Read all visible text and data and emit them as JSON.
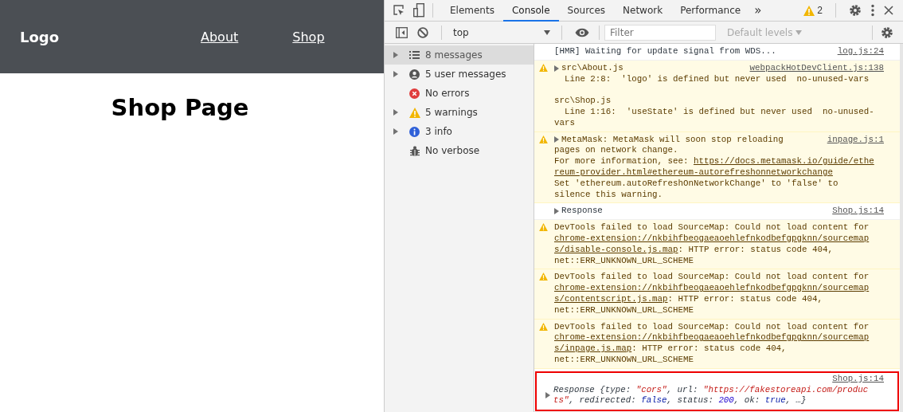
{
  "app": {
    "logo": "Logo",
    "nav_links": [
      {
        "label": "About"
      },
      {
        "label": "Shop"
      }
    ],
    "heading": "Shop Page"
  },
  "devtools": {
    "tabs": [
      {
        "label": "Elements",
        "selected": false
      },
      {
        "label": "Console",
        "selected": true
      },
      {
        "label": "Sources",
        "selected": false
      },
      {
        "label": "Network",
        "selected": false
      },
      {
        "label": "Performance",
        "selected": false
      }
    ],
    "more_tabs": "»",
    "warning_count": "2",
    "context": "top",
    "filter": {
      "placeholder": "Filter"
    },
    "levels": "Default levels",
    "sidebar": [
      {
        "label": "8 messages",
        "kind": "all",
        "expandable": true,
        "selected": true
      },
      {
        "label": "5 user messages",
        "kind": "user",
        "expandable": true,
        "selected": false
      },
      {
        "label": "No errors",
        "kind": "error",
        "expandable": false,
        "selected": false
      },
      {
        "label": "5 warnings",
        "kind": "warning",
        "expandable": true,
        "selected": false
      },
      {
        "label": "3 info",
        "kind": "info",
        "expandable": true,
        "selected": false
      },
      {
        "label": "No verbose",
        "kind": "verbose",
        "expandable": false,
        "selected": false
      }
    ],
    "messages": [
      {
        "kind": "log",
        "expandable": false,
        "highlighted": false,
        "source": "log.js:24",
        "lines": [
          {
            "gap_before": false,
            "parts": [
              {
                "kind": "text",
                "text": "[HMR] Waiting for update signal from WDS..."
              }
            ]
          }
        ]
      },
      {
        "kind": "warning",
        "expandable": true,
        "highlighted": false,
        "source": "webpackHotDevClient.js:138",
        "lines": [
          {
            "gap_before": false,
            "parts": [
              {
                "kind": "text",
                "text": "src\\About.js"
              }
            ]
          },
          {
            "gap_before": false,
            "parts": [
              {
                "kind": "text",
                "text": "  Line 2:8:  'logo' is defined but never used  no-unused-vars"
              }
            ]
          },
          {
            "gap_before": true,
            "parts": [
              {
                "kind": "text",
                "text": "src\\Shop.js"
              }
            ]
          },
          {
            "gap_before": false,
            "parts": [
              {
                "kind": "text",
                "text": "  Line 1:16:  'useState' is defined but never used  no-unused-"
              }
            ]
          },
          {
            "gap_before": false,
            "parts": [
              {
                "kind": "text",
                "text": "vars"
              }
            ]
          }
        ]
      },
      {
        "kind": "warning",
        "expandable": true,
        "highlighted": false,
        "source": "inpage.js:1",
        "lines": [
          {
            "gap_before": false,
            "parts": [
              {
                "kind": "text",
                "text": "MetaMask: MetaMask will soon stop reloading"
              }
            ]
          },
          {
            "gap_before": false,
            "parts": [
              {
                "kind": "text",
                "text": "pages on network change."
              }
            ]
          },
          {
            "gap_before": false,
            "parts": [
              {
                "kind": "text",
                "text": "For more information, see: "
              },
              {
                "kind": "link",
                "text": "https://docs.metamask.io/guide/ethe"
              }
            ]
          },
          {
            "gap_before": false,
            "parts": [
              {
                "kind": "link",
                "text": "reum-provider.html#ethereum-autorefreshonnetworkchange"
              }
            ]
          },
          {
            "gap_before": false,
            "parts": [
              {
                "kind": "text",
                "text": "Set 'ethereum.autoRefreshOnNetworkChange' to 'false' to"
              }
            ]
          },
          {
            "gap_before": false,
            "parts": [
              {
                "kind": "text",
                "text": "silence this warning."
              }
            ]
          }
        ]
      },
      {
        "kind": "log",
        "expandable": true,
        "highlighted": false,
        "source": "Shop.js:14",
        "lines": [
          {
            "gap_before": false,
            "parts": [
              {
                "kind": "text",
                "text": "Response"
              }
            ]
          }
        ]
      },
      {
        "kind": "warning",
        "expandable": false,
        "highlighted": false,
        "lines": [
          {
            "gap_before": false,
            "parts": [
              {
                "kind": "text",
                "text": "DevTools failed to load SourceMap: Could not load content for"
              }
            ]
          },
          {
            "gap_before": false,
            "parts": [
              {
                "kind": "link",
                "text": "chrome-extension://nkbihfbeogaeaoehlefnkodbefgpgknn/sourcemap"
              }
            ]
          },
          {
            "gap_before": false,
            "parts": [
              {
                "kind": "link",
                "text": "s/disable-console.js.map"
              },
              {
                "kind": "text",
                "text": ": HTTP error: status code 404,"
              }
            ]
          },
          {
            "gap_before": false,
            "parts": [
              {
                "kind": "text",
                "text": "net::ERR_UNKNOWN_URL_SCHEME"
              }
            ]
          }
        ]
      },
      {
        "kind": "warning",
        "expandable": false,
        "highlighted": false,
        "lines": [
          {
            "gap_before": false,
            "parts": [
              {
                "kind": "text",
                "text": "DevTools failed to load SourceMap: Could not load content for"
              }
            ]
          },
          {
            "gap_before": false,
            "parts": [
              {
                "kind": "link",
                "text": "chrome-extension://nkbihfbeogaeaoehlefnkodbefgpgknn/sourcemap"
              }
            ]
          },
          {
            "gap_before": false,
            "parts": [
              {
                "kind": "link",
                "text": "s/contentscript.js.map"
              },
              {
                "kind": "text",
                "text": ": HTTP error: status code 404,"
              }
            ]
          },
          {
            "gap_before": false,
            "parts": [
              {
                "kind": "text",
                "text": "net::ERR_UNKNOWN_URL_SCHEME"
              }
            ]
          }
        ]
      },
      {
        "kind": "warning",
        "expandable": false,
        "highlighted": false,
        "lines": [
          {
            "gap_before": false,
            "parts": [
              {
                "kind": "text",
                "text": "DevTools failed to load SourceMap: Could not load content for"
              }
            ]
          },
          {
            "gap_before": false,
            "parts": [
              {
                "kind": "link",
                "text": "chrome-extension://nkbihfbeogaeaoehlefnkodbefgpgknn/sourcemap"
              }
            ]
          },
          {
            "gap_before": false,
            "parts": [
              {
                "kind": "link",
                "text": "s/inpage.js.map"
              },
              {
                "kind": "text",
                "text": ": HTTP error: status code 404,"
              }
            ]
          },
          {
            "gap_before": false,
            "parts": [
              {
                "kind": "text",
                "text": "net::ERR_UNKNOWN_URL_SCHEME"
              }
            ]
          }
        ]
      },
      {
        "kind": "object",
        "expandable": true,
        "highlighted": true,
        "source": "Shop.js:14",
        "lines": [
          {
            "gap_before": false,
            "parts": [
              {
                "kind": "plain",
                "text": "Response {type: "
              },
              {
                "kind": "string",
                "text": "\"cors\""
              },
              {
                "kind": "plain",
                "text": ", url: "
              },
              {
                "kind": "string",
                "text": "\"https://fakestoreapi.com/produc"
              }
            ]
          },
          {
            "gap_before": false,
            "parts": [
              {
                "kind": "string",
                "text": "ts\""
              },
              {
                "kind": "plain",
                "text": ", redirected: "
              },
              {
                "kind": "keyword",
                "text": "false"
              },
              {
                "kind": "plain",
                "text": ", status: "
              },
              {
                "kind": "number",
                "text": "200"
              },
              {
                "kind": "plain",
                "text": ", ok: "
              },
              {
                "kind": "keyword",
                "text": "true"
              },
              {
                "kind": "plain",
                "text": ", …}"
              }
            ]
          }
        ]
      }
    ]
  }
}
